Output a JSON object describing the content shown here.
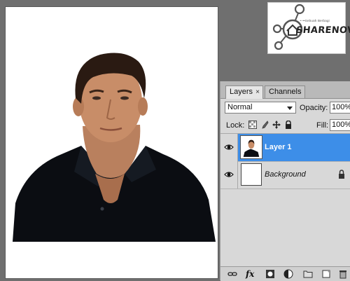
{
  "canvas": {
    "background": "#ffffff"
  },
  "watermark": {
    "small_text": "• ••Sebuah Berbagi",
    "brand": "SHARENOVEL",
    "icon": "house-network-logo"
  },
  "layers_panel": {
    "tabs": [
      {
        "label": "Layers",
        "active": true
      },
      {
        "label": "Channels",
        "active": false
      }
    ],
    "close_glyph": "×",
    "blend_mode": "Normal",
    "opacity_label": "Opacity:",
    "opacity_value": "100%",
    "lock_label": "Lock:",
    "lock_icons": [
      "lock-transparent-icon",
      "lock-paint-icon",
      "lock-move-icon",
      "lock-all-icon"
    ],
    "fill_label": "Fill:",
    "fill_value": "100%",
    "layers": [
      {
        "name": "Layer 1",
        "selected": true,
        "visible": true,
        "locked": false
      },
      {
        "name": "Background",
        "selected": false,
        "visible": true,
        "locked": true
      }
    ],
    "bottom_icons": [
      "link-layers-icon",
      "fx-icon",
      "layer-mask-icon",
      "adjustment-layer-icon",
      "group-folder-icon",
      "new-layer-icon",
      "delete-layer-icon"
    ],
    "fx_label": "fx",
    "selection_color": "#3d8ee8"
  }
}
